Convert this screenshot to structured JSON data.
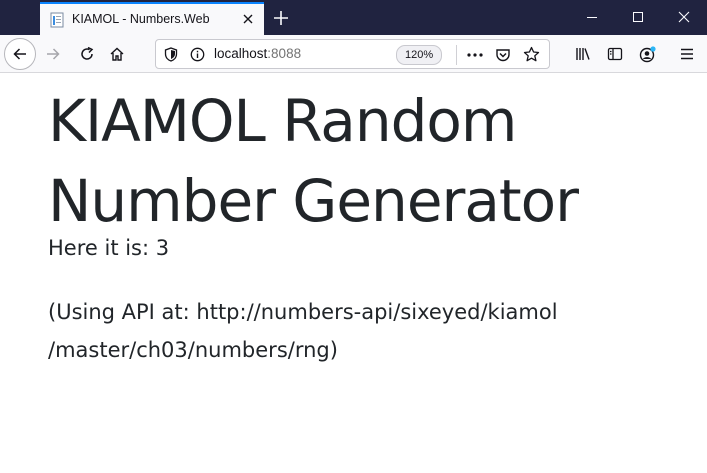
{
  "browser": {
    "tab_title": "KIAMOL - Numbers.Web",
    "url_host": "localhost",
    "url_port": ":8088",
    "zoom_level": "120%"
  },
  "icons": {
    "tab": [
      "document-favicon-icon",
      "close-icon"
    ],
    "titlebar": [
      "plus-icon",
      "minimize-icon",
      "maximize-icon",
      "close-icon"
    ],
    "toolbar": [
      "back-arrow-icon",
      "forward-arrow-icon",
      "reload-icon",
      "home-icon",
      "shield-icon",
      "info-icon",
      "more-actions-icon",
      "pocket-icon",
      "star-icon",
      "library-icon",
      "sidebar-icon",
      "account-icon",
      "hamburger-menu-icon"
    ]
  },
  "colors": {
    "titlebar_bg": "#202340",
    "tab_accent": "#0a84ff",
    "text": "#212529"
  },
  "page": {
    "title_line1": "KIAMOL Random",
    "title_line2": "Number Generator",
    "result_text": "Here it is: 3",
    "api_line1": "(Using API at: http://numbers-api/sixeyed/kiamol",
    "api_line2": "/master/ch03/numbers/rng)"
  }
}
